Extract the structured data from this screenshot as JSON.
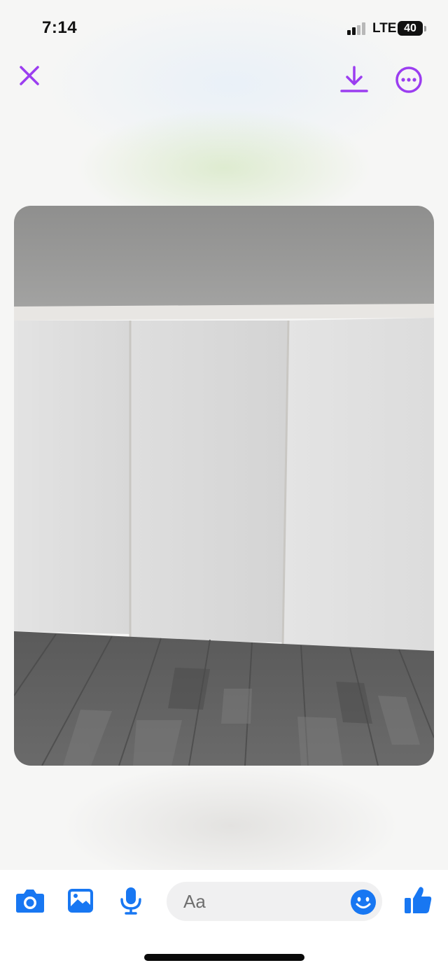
{
  "status_bar": {
    "time": "7:14",
    "network": "LTE",
    "battery": "40"
  },
  "top_bar": {
    "close_icon": "close-icon",
    "download_icon": "download-icon",
    "more_icon": "more-options-icon",
    "accent_color": "#9b3df0"
  },
  "photo": {
    "subject": "sliding-closet-doors-photo"
  },
  "composer": {
    "placeholder": "Aa",
    "icons": [
      "camera-icon",
      "gallery-icon",
      "microphone-icon",
      "emoji-icon",
      "thumbs-up-icon"
    ],
    "accent_color": "#1877f2"
  }
}
